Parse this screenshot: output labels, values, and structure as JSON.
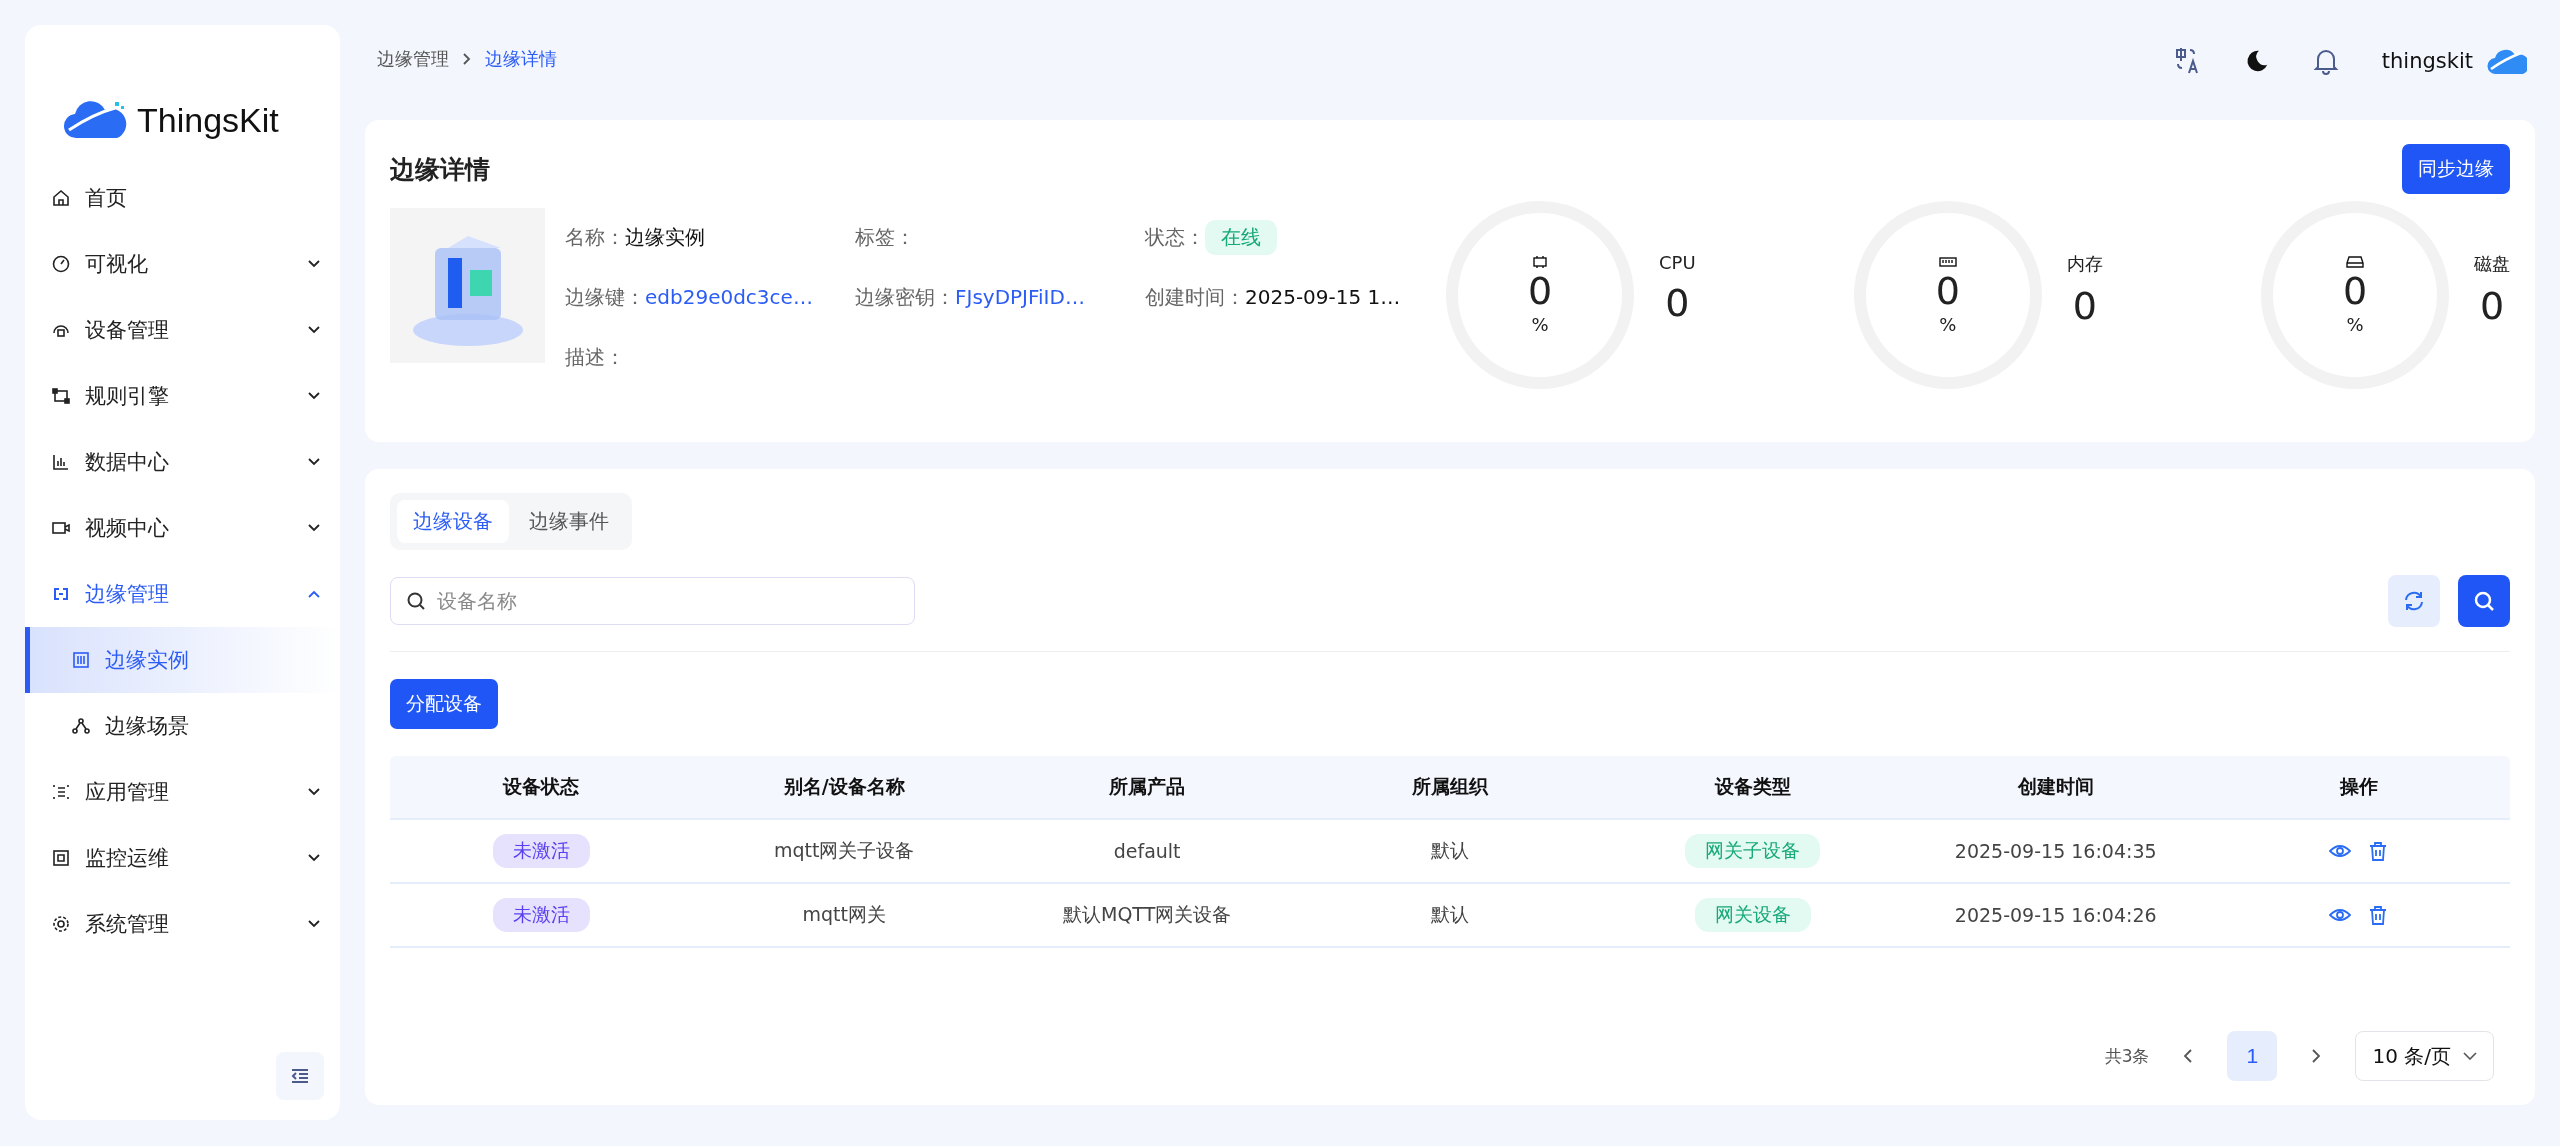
{
  "sidebar": {
    "logo_text": "ThingsKit",
    "items": [
      {
        "label": "首页",
        "kind": "link",
        "selected": false
      },
      {
        "label": "可视化",
        "kind": "group",
        "expanded": false,
        "selected": false
      },
      {
        "label": "设备管理",
        "kind": "group",
        "expanded": false,
        "selected": false
      },
      {
        "label": "规则引擎",
        "kind": "group",
        "expanded": false,
        "selected": false
      },
      {
        "label": "数据中心",
        "kind": "group",
        "expanded": false,
        "selected": false
      },
      {
        "label": "视频中心",
        "kind": "group",
        "expanded": false,
        "selected": false
      },
      {
        "label": "边缘管理",
        "kind": "group",
        "expanded": true,
        "selected": true,
        "children": [
          {
            "label": "边缘实例",
            "selected": true
          },
          {
            "label": "边缘场景",
            "selected": false
          }
        ]
      },
      {
        "label": "应用管理",
        "kind": "group",
        "expanded": false,
        "selected": false
      },
      {
        "label": "监控运维",
        "kind": "group",
        "expanded": false,
        "selected": false
      },
      {
        "label": "系统管理",
        "kind": "group",
        "expanded": false,
        "selected": false
      }
    ]
  },
  "breadcrumb": [
    {
      "label": "边缘管理",
      "selected": false
    },
    {
      "label": "边缘详情",
      "selected": true
    }
  ],
  "header": {
    "username": "thingskit"
  },
  "detail": {
    "title": "边缘详情",
    "sync_button": "同步边缘",
    "fields": [
      {
        "label": "名称：",
        "value": "边缘实例",
        "kind": "text"
      },
      {
        "label": "标签：",
        "kind": "empty"
      },
      {
        "label": "状态：",
        "value": "在线",
        "kind": "tag"
      },
      {
        "label": "边缘键：",
        "value": "edb29e0dc3ce…",
        "kind": "link"
      },
      {
        "label": "边缘密钥：",
        "value": "FJsyDPJFiID…",
        "kind": "link"
      },
      {
        "label": "创建时间：",
        "value": "2025-09-15 1…",
        "kind": "text"
      },
      {
        "label": "描述：",
        "kind": "empty"
      }
    ],
    "gauges": [
      {
        "kind": "cpu",
        "value": "0",
        "unit": "%",
        "level": 0,
        "label": "CPU",
        "reading": "0"
      },
      {
        "kind": "memory",
        "value": "0",
        "unit": "%",
        "level": 0,
        "label": "内存",
        "reading": "0"
      },
      {
        "kind": "disk",
        "value": "0",
        "unit": "%",
        "level": 0,
        "label": "磁盘",
        "reading": "0"
      }
    ]
  },
  "devices": {
    "tabs": [
      {
        "label": "边缘设备",
        "selected": true
      },
      {
        "label": "边缘事件",
        "selected": false
      }
    ],
    "search": {
      "placeholder": "设备名称"
    },
    "assign_button": "分配设备",
    "table": {
      "columns": [
        "设备状态",
        "别名/设备名称",
        "所属产品",
        "所属组织",
        "设备类型",
        "创建时间",
        "操作"
      ],
      "rows": [
        {
          "status": "未激活",
          "kind": "inactive",
          "name": "mqtt网关子设备",
          "product": "default",
          "org": "默认",
          "type": "网关子设备",
          "created": "2025-09-15 16:04:35"
        },
        {
          "status": "未激活",
          "kind": "inactive",
          "name": "mqtt网关",
          "product": "默认MQTT网关设备",
          "org": "默认",
          "type": "网关设备",
          "created": "2025-09-15 16:04:26"
        }
      ]
    },
    "pagination": {
      "total": "共3条",
      "pages": [
        {
          "label": "1",
          "selected": true
        }
      ],
      "page_size": "10 条/页"
    }
  }
}
